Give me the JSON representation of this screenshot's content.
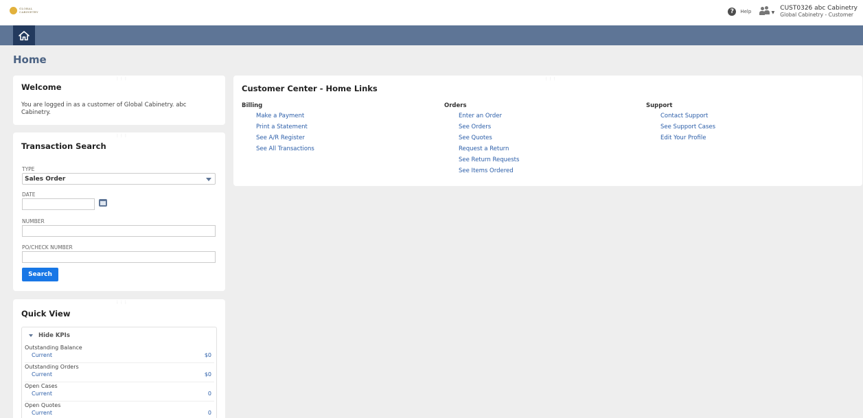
{
  "header": {
    "logo_text": "GLOBAL CABINETRY",
    "help_label": "Help",
    "user_name": "CUST0326 abc Cabinetry",
    "user_role": "Global Cabinetry - Customer",
    "icons": {
      "help": "help-circle-icon",
      "roles": "role-switch-icon",
      "home": "home-icon"
    }
  },
  "page": {
    "title": "Home"
  },
  "welcome": {
    "title": "Welcome",
    "text": "You are logged in as a customer of Global Cabinetry. abc Cabinetry."
  },
  "transaction_search": {
    "title": "Transaction Search",
    "type_label": "TYPE",
    "type_value": "Sales Order",
    "date_label": "DATE",
    "date_value": "",
    "number_label": "NUMBER",
    "number_value": "",
    "po_label": "PO/CHECK NUMBER",
    "po_value": "",
    "search_label": "Search"
  },
  "quick_view": {
    "title": "Quick View",
    "toggle_label": "Hide KPIs",
    "kpis": [
      {
        "name": "Outstanding Balance",
        "period": "Current",
        "value": "$0"
      },
      {
        "name": "Outstanding Orders",
        "period": "Current",
        "value": "$0"
      },
      {
        "name": "Open Cases",
        "period": "Current",
        "value": "0"
      },
      {
        "name": "Open Quotes",
        "period": "Current",
        "value": "0"
      }
    ]
  },
  "customer_center": {
    "title": "Customer Center - Home Links",
    "columns": [
      {
        "heading": "Billing",
        "links": [
          "Make a Payment",
          "Print a Statement",
          "See A/R Register",
          "See All Transactions"
        ]
      },
      {
        "heading": "Orders",
        "links": [
          "Enter an Order",
          "See Orders",
          "See Quotes",
          "Request a Return",
          "See Return Requests",
          "See Items Ordered"
        ]
      },
      {
        "heading": "Support",
        "links": [
          "Contact Support",
          "See Support Cases",
          "Edit Your Profile"
        ]
      }
    ]
  },
  "colors": {
    "nav": "#5e7596",
    "home_button": "#233a5e",
    "link": "#2a5da8",
    "search_button": "#1877e6",
    "page_bg": "#eeeeee"
  }
}
